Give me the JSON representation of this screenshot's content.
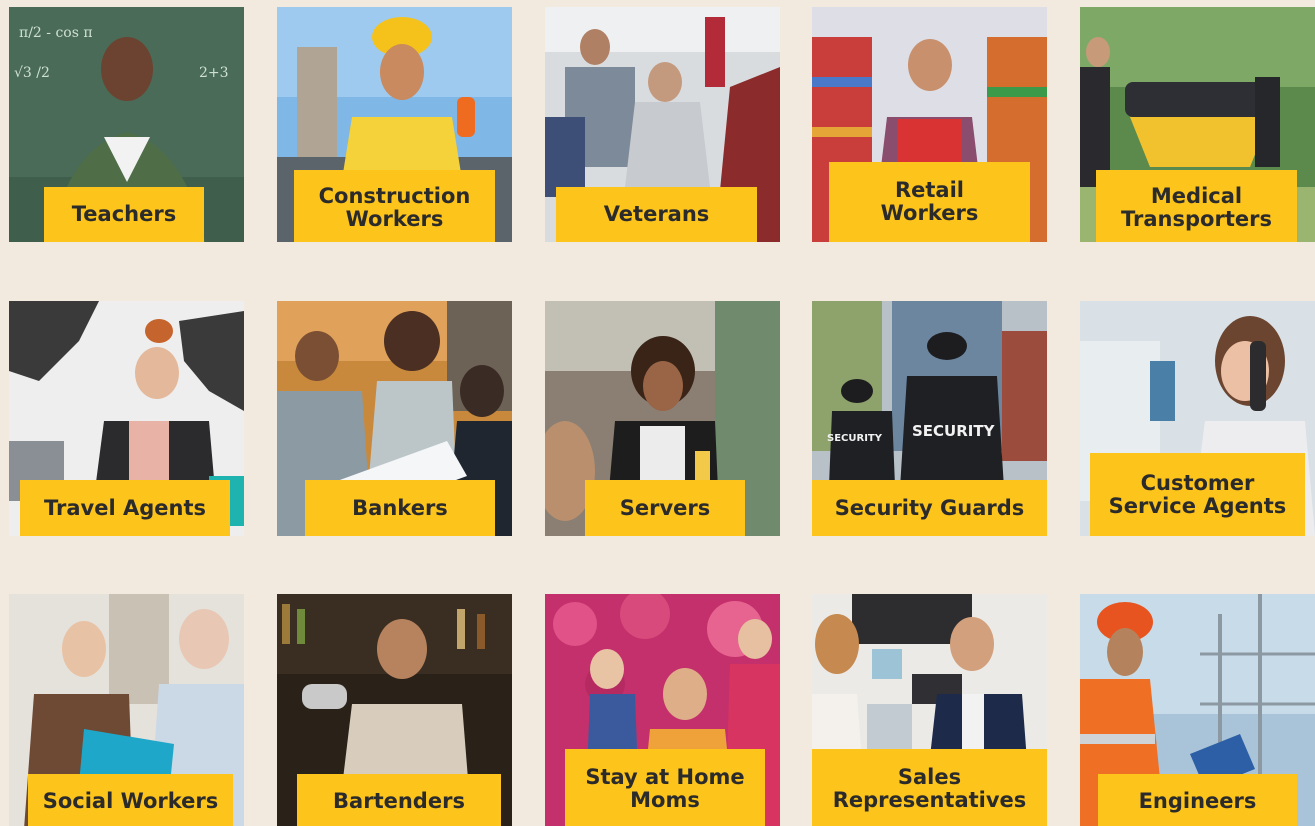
{
  "tiles": [
    {
      "label": "Teachers",
      "photo": "teacher-photo"
    },
    {
      "label": "Construction\nWorkers",
      "photo": "construction-worker-photo"
    },
    {
      "label": "Veterans",
      "photo": "veterans-photo"
    },
    {
      "label": "Retail\nWorkers",
      "photo": "retail-worker-photo"
    },
    {
      "label": "Medical\nTransporters",
      "photo": "medical-transport-photo"
    },
    {
      "label": "Travel Agents",
      "photo": "travel-agent-photo"
    },
    {
      "label": "Bankers",
      "photo": "bankers-photo"
    },
    {
      "label": "Servers",
      "photo": "server-photo"
    },
    {
      "label": "Security Guards",
      "photo": "security-guards-photo"
    },
    {
      "label": "Customer\nService Agents",
      "photo": "customer-service-photo"
    },
    {
      "label": "Social Workers",
      "photo": "social-workers-photo"
    },
    {
      "label": "Bartenders",
      "photo": "bartender-photo"
    },
    {
      "label": "Stay at Home\nMoms",
      "photo": "stay-at-home-moms-photo"
    },
    {
      "label": "Sales\nRepresentatives",
      "photo": "sales-representatives-photo"
    },
    {
      "label": "Engineers",
      "photo": "engineer-photo"
    }
  ],
  "colors": {
    "background": "#f3eadf",
    "label_bg": "#fdc41b",
    "label_text": "#2b2b2b"
  }
}
